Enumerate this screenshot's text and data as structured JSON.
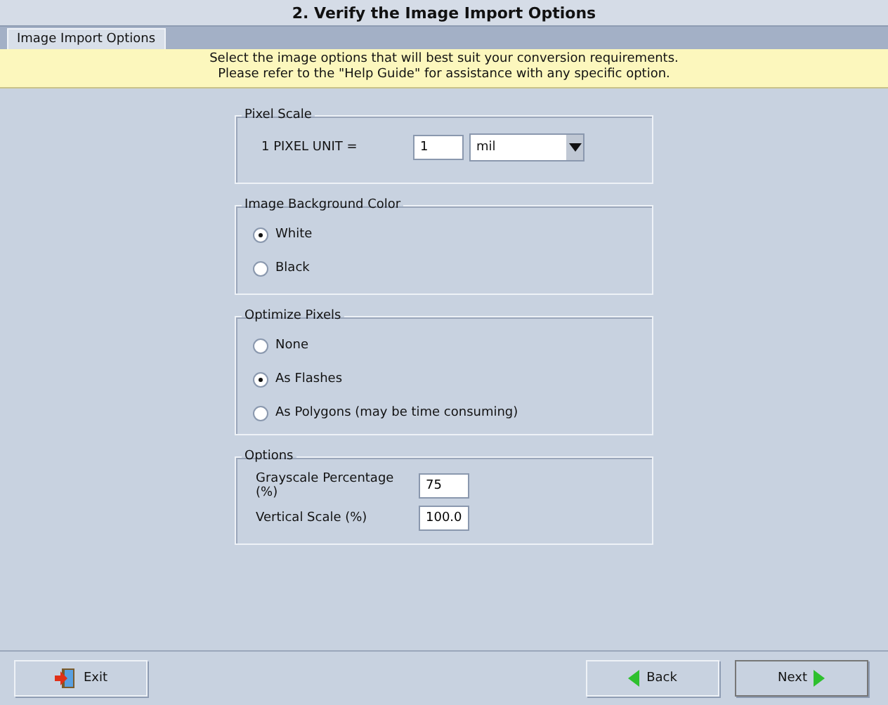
{
  "window": {
    "title": "2.  Verify the Image Import Options"
  },
  "tabs": [
    {
      "label": "Image Import Options",
      "selected": true
    }
  ],
  "notice": [
    "Select the image options that will best suit your conversion requirements.",
    "Please refer to the \"Help Guide\" for assistance with any specific option."
  ],
  "pixel_scale": {
    "title": "Pixel Scale",
    "label": "1 PIXEL UNIT =",
    "value": "1",
    "unit": "mil"
  },
  "background_color": {
    "title": "Image Background Color",
    "options": [
      {
        "label": "White",
        "selected": true
      },
      {
        "label": "Black",
        "selected": false
      }
    ]
  },
  "optimize_pixels": {
    "title": "Optimize Pixels",
    "options": [
      {
        "label": "None",
        "selected": false
      },
      {
        "label": "As Flashes",
        "selected": true
      },
      {
        "label": "As Polygons (may be time consuming)",
        "selected": false
      }
    ]
  },
  "options": {
    "title": "Options",
    "fields": [
      {
        "label": "Grayscale Percentage (%)",
        "value": "75"
      },
      {
        "label": "Vertical Scale (%)",
        "value": "100.0"
      }
    ]
  },
  "buttons": {
    "exit": "Exit",
    "back": "Back",
    "next": "Next"
  }
}
